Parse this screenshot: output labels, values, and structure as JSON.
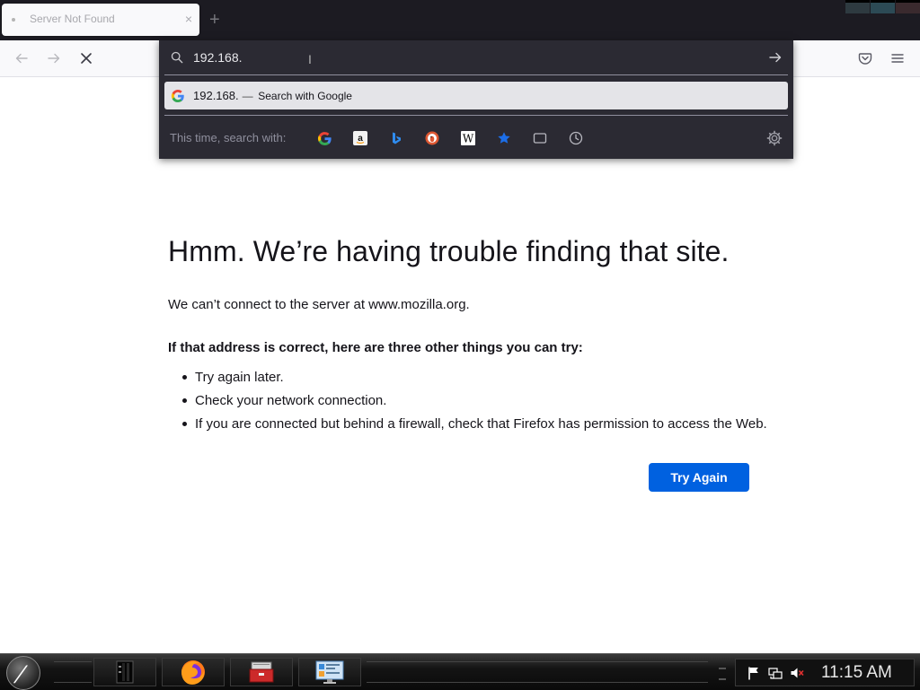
{
  "tab": {
    "title": "Server Not Found",
    "close": "×",
    "new_tab": "+"
  },
  "urlbar": {
    "value": "192.168.",
    "suggestion": {
      "query": "192.168.",
      "separator": "—",
      "action": "Search with Google"
    },
    "oneoff_label": "This time, search with:",
    "engines": [
      "google-icon",
      "amazon-icon",
      "bing-icon",
      "duckduckgo-icon",
      "wikipedia-icon",
      "bookmarks-icon",
      "tabs-icon",
      "history-icon"
    ]
  },
  "error": {
    "title": "Hmm. We’re having trouble finding that site.",
    "description": "We can’t connect to the server at www.mozilla.org.",
    "heading": "If that address is correct, here are three other things you can try:",
    "suggestions": [
      "Try again later.",
      "Check your network connection.",
      "If you are connected but behind a firewall, check that Firefox has permission to access the Web."
    ],
    "button": "Try Again"
  },
  "taskbar": {
    "apps": [
      "terminal-icon",
      "firefox-icon",
      "toolbox-icon",
      "control-panel-icon"
    ],
    "tray": [
      "flag-icon",
      "network-icon",
      "volume-muted-icon"
    ],
    "clock": "11:15 AM"
  },
  "colors": {
    "accent": "#0061e0",
    "tabstrip_bg": "#1c1b22",
    "panel_bg": "#2b2a33"
  }
}
